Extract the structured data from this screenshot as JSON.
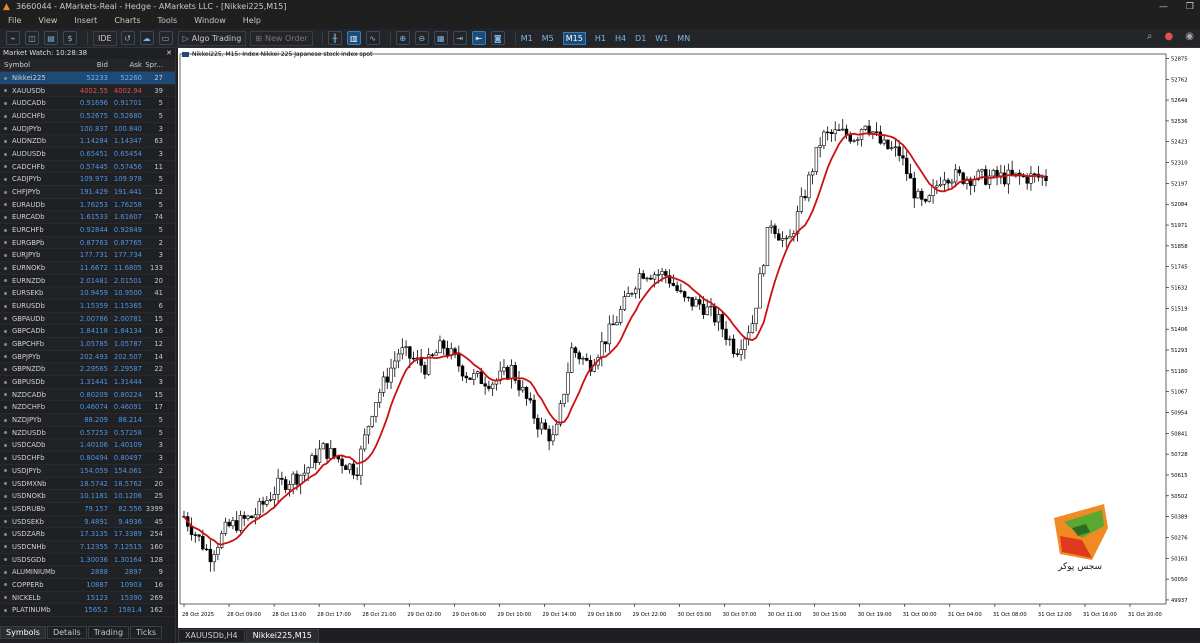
{
  "window": {
    "title": "3660044 - AMarkets-Real - Hedge - AMarkets LLC - [Nikkei225,M15]"
  },
  "menu": [
    "File",
    "View",
    "Insert",
    "Charts",
    "Tools",
    "Window",
    "Help"
  ],
  "toolbar": {
    "ide": "IDE",
    "algo": "Algo Trading",
    "new_order": "New Order",
    "timeframes": [
      "M1",
      "M5",
      "M15",
      "H1",
      "H4",
      "D1",
      "W1",
      "MN"
    ],
    "active_tf": "M15"
  },
  "market_watch": {
    "title": "Market Watch: 10:28:38",
    "headers": {
      "symbol": "Symbol",
      "bid": "Bid",
      "ask": "Ask",
      "spread": "Spr..."
    },
    "rows": [
      [
        "Nikkei225",
        "52233",
        "52260",
        "27"
      ],
      [
        "XAUUSDb",
        "4002.55",
        "4002.94",
        "39"
      ],
      [
        "AUDCADb",
        "0.91696",
        "0.91701",
        "5"
      ],
      [
        "AUDCHFb",
        "0.52675",
        "0.52680",
        "5"
      ],
      [
        "AUDJPYb",
        "100.837",
        "100.840",
        "3"
      ],
      [
        "AUDNZDb",
        "1.14284",
        "1.14347",
        "63"
      ],
      [
        "AUDUSDb",
        "0.65451",
        "0.65454",
        "3"
      ],
      [
        "CADCHFb",
        "0.57445",
        "0.57456",
        "11"
      ],
      [
        "CADJPYb",
        "109.973",
        "109.978",
        "5"
      ],
      [
        "CHFJPYb",
        "191.429",
        "191.441",
        "12"
      ],
      [
        "EURAUDb",
        "1.76253",
        "1.76258",
        "5"
      ],
      [
        "EURCADb",
        "1.61533",
        "1.61607",
        "74"
      ],
      [
        "EURCHFb",
        "0.92844",
        "0.92849",
        "5"
      ],
      [
        "EURGBPb",
        "0.87763",
        "0.87765",
        "2"
      ],
      [
        "EURJPYb",
        "177.731",
        "177.734",
        "3"
      ],
      [
        "EURNOKb",
        "11.6672",
        "11.6805",
        "133"
      ],
      [
        "EURNZDb",
        "2.01481",
        "2.01501",
        "20"
      ],
      [
        "EURSEKb",
        "10.9459",
        "10.9500",
        "41"
      ],
      [
        "EURUSDb",
        "1.15359",
        "1.15365",
        "6"
      ],
      [
        "GBPAUDb",
        "2.00786",
        "2.00781",
        "15"
      ],
      [
        "GBPCADb",
        "1.84118",
        "1.84134",
        "16"
      ],
      [
        "GBPCHFb",
        "1.05785",
        "1.05787",
        "12"
      ],
      [
        "GBPJPYb",
        "202.493",
        "202.507",
        "14"
      ],
      [
        "GBPNZDb",
        "2.29565",
        "2.29587",
        "22"
      ],
      [
        "GBPUSDb",
        "1.31441",
        "1.31444",
        "3"
      ],
      [
        "NZDCADb",
        "0.80209",
        "0.80224",
        "15"
      ],
      [
        "NZDCHFb",
        "0.46074",
        "0.46091",
        "17"
      ],
      [
        "NZDJPYb",
        "88.209",
        "88.214",
        "5"
      ],
      [
        "NZDUSDb",
        "0.57253",
        "0.57258",
        "5"
      ],
      [
        "USDCADb",
        "1.40106",
        "1.40109",
        "3"
      ],
      [
        "USDCHFb",
        "0.80494",
        "0.80497",
        "3"
      ],
      [
        "USDJPYb",
        "154.059",
        "154.061",
        "2"
      ],
      [
        "USDMXNb",
        "18.5742",
        "18.5762",
        "20"
      ],
      [
        "USDNOKb",
        "10.1181",
        "10.1206",
        "25"
      ],
      [
        "USDRUBb",
        "79.157",
        "82.556",
        "3399"
      ],
      [
        "USDSEKb",
        "9.4891",
        "9.4936",
        "45"
      ],
      [
        "USDZARb",
        "17.3135",
        "17.3389",
        "254"
      ],
      [
        "USDCNHb",
        "7.12355",
        "7.12515",
        "160"
      ],
      [
        "USDSGDb",
        "1.30036",
        "1.30164",
        "128"
      ],
      [
        "ALUMINIUMb",
        "2888",
        "2897",
        "9"
      ],
      [
        "COPPERb",
        "10887",
        "10903",
        "16"
      ],
      [
        "NICKELb",
        "15123",
        "15390",
        "269"
      ],
      [
        "PLATINUMb",
        "1565.2",
        "1581.4",
        "162"
      ]
    ],
    "tabs": [
      "Symbols",
      "Details",
      "Trading",
      "Ticks"
    ]
  },
  "chart": {
    "label": "Nikkei225, M15:  Index Nikkei 225 Japanese stock index spot",
    "tabs": [
      "XAUUSDb,H4",
      "Nikkei225,M15"
    ],
    "watermark": "سجس پوکر"
  },
  "chart_data": {
    "type": "candlestick",
    "price_ticks": [
      "52875",
      "52762",
      "52649",
      "52536",
      "52423",
      "52310",
      "52197",
      "52084",
      "51971",
      "51858",
      "51745",
      "51632",
      "51519",
      "51406",
      "51293",
      "51180",
      "51067",
      "50954",
      "50841",
      "50728",
      "50615",
      "50502",
      "50389",
      "50276",
      "50163",
      "50050",
      "49937"
    ],
    "time_ticks": [
      "28 Oct 2025",
      "28 Oct 09:00",
      "28 Oct 13:00",
      "28 Oct 17:00",
      "28 Oct 21:00",
      "29 Oct 02:00",
      "29 Oct 06:00",
      "29 Oct 10:00",
      "29 Oct 14:00",
      "29 Oct 18:00",
      "29 Oct 22:00",
      "30 Oct 03:00",
      "30 Oct 07:00",
      "30 Oct 11:00",
      "30 Oct 15:00",
      "30 Oct 19:00",
      "31 Oct 00:00",
      "31 Oct 04:00",
      "31 Oct 08:00",
      "31 Oct 12:00",
      "31 Oct 16:00",
      "31 Oct 20:00"
    ],
    "path": [
      [
        0,
        50390
      ],
      [
        0.03,
        50180
      ],
      [
        0.05,
        50330
      ],
      [
        0.08,
        50390
      ],
      [
        0.11,
        50560
      ],
      [
        0.14,
        50630
      ],
      [
        0.16,
        50760
      ],
      [
        0.18,
        50700
      ],
      [
        0.2,
        50640
      ],
      [
        0.22,
        51000
      ],
      [
        0.25,
        51290
      ],
      [
        0.28,
        51200
      ],
      [
        0.3,
        51320
      ],
      [
        0.33,
        51150
      ],
      [
        0.36,
        51120
      ],
      [
        0.38,
        51190
      ],
      [
        0.41,
        50900
      ],
      [
        0.43,
        50800
      ],
      [
        0.45,
        51300
      ],
      [
        0.47,
        51210
      ],
      [
        0.5,
        51440
      ],
      [
        0.53,
        51720
      ],
      [
        0.56,
        51700
      ],
      [
        0.58,
        51560
      ],
      [
        0.6,
        51540
      ],
      [
        0.62,
        51450
      ],
      [
        0.64,
        51290
      ],
      [
        0.66,
        51450
      ],
      [
        0.68,
        52000
      ],
      [
        0.7,
        51850
      ],
      [
        0.72,
        52140
      ],
      [
        0.74,
        52450
      ],
      [
        0.76,
        52470
      ],
      [
        0.78,
        52450
      ],
      [
        0.79,
        52540
      ],
      [
        0.81,
        52400
      ],
      [
        0.83,
        52360
      ],
      [
        0.85,
        52120
      ],
      [
        0.86,
        52060
      ],
      [
        0.88,
        52250
      ],
      [
        0.9,
        52230
      ]
    ],
    "ma_color": "#cc1010",
    "candle_color": "#000000"
  }
}
